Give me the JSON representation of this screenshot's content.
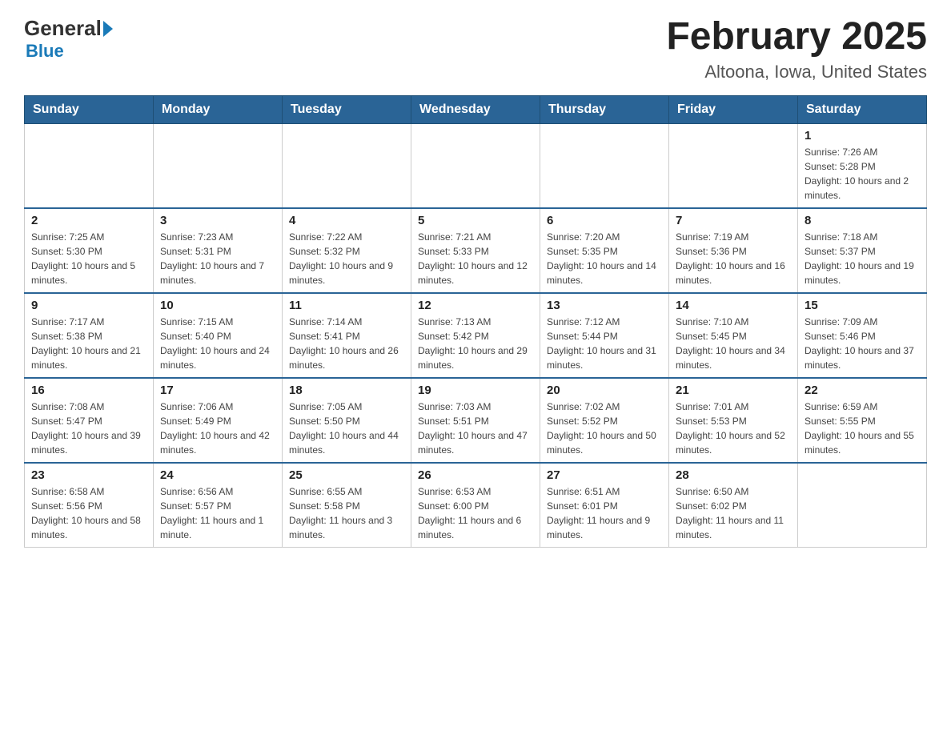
{
  "logo": {
    "general": "General",
    "blue": "Blue"
  },
  "header": {
    "title": "February 2025",
    "subtitle": "Altoona, Iowa, United States"
  },
  "weekdays": [
    "Sunday",
    "Monday",
    "Tuesday",
    "Wednesday",
    "Thursday",
    "Friday",
    "Saturday"
  ],
  "weeks": [
    [
      {
        "day": "",
        "info": ""
      },
      {
        "day": "",
        "info": ""
      },
      {
        "day": "",
        "info": ""
      },
      {
        "day": "",
        "info": ""
      },
      {
        "day": "",
        "info": ""
      },
      {
        "day": "",
        "info": ""
      },
      {
        "day": "1",
        "info": "Sunrise: 7:26 AM\nSunset: 5:28 PM\nDaylight: 10 hours and 2 minutes."
      }
    ],
    [
      {
        "day": "2",
        "info": "Sunrise: 7:25 AM\nSunset: 5:30 PM\nDaylight: 10 hours and 5 minutes."
      },
      {
        "day": "3",
        "info": "Sunrise: 7:23 AM\nSunset: 5:31 PM\nDaylight: 10 hours and 7 minutes."
      },
      {
        "day": "4",
        "info": "Sunrise: 7:22 AM\nSunset: 5:32 PM\nDaylight: 10 hours and 9 minutes."
      },
      {
        "day": "5",
        "info": "Sunrise: 7:21 AM\nSunset: 5:33 PM\nDaylight: 10 hours and 12 minutes."
      },
      {
        "day": "6",
        "info": "Sunrise: 7:20 AM\nSunset: 5:35 PM\nDaylight: 10 hours and 14 minutes."
      },
      {
        "day": "7",
        "info": "Sunrise: 7:19 AM\nSunset: 5:36 PM\nDaylight: 10 hours and 16 minutes."
      },
      {
        "day": "8",
        "info": "Sunrise: 7:18 AM\nSunset: 5:37 PM\nDaylight: 10 hours and 19 minutes."
      }
    ],
    [
      {
        "day": "9",
        "info": "Sunrise: 7:17 AM\nSunset: 5:38 PM\nDaylight: 10 hours and 21 minutes."
      },
      {
        "day": "10",
        "info": "Sunrise: 7:15 AM\nSunset: 5:40 PM\nDaylight: 10 hours and 24 minutes."
      },
      {
        "day": "11",
        "info": "Sunrise: 7:14 AM\nSunset: 5:41 PM\nDaylight: 10 hours and 26 minutes."
      },
      {
        "day": "12",
        "info": "Sunrise: 7:13 AM\nSunset: 5:42 PM\nDaylight: 10 hours and 29 minutes."
      },
      {
        "day": "13",
        "info": "Sunrise: 7:12 AM\nSunset: 5:44 PM\nDaylight: 10 hours and 31 minutes."
      },
      {
        "day": "14",
        "info": "Sunrise: 7:10 AM\nSunset: 5:45 PM\nDaylight: 10 hours and 34 minutes."
      },
      {
        "day": "15",
        "info": "Sunrise: 7:09 AM\nSunset: 5:46 PM\nDaylight: 10 hours and 37 minutes."
      }
    ],
    [
      {
        "day": "16",
        "info": "Sunrise: 7:08 AM\nSunset: 5:47 PM\nDaylight: 10 hours and 39 minutes."
      },
      {
        "day": "17",
        "info": "Sunrise: 7:06 AM\nSunset: 5:49 PM\nDaylight: 10 hours and 42 minutes."
      },
      {
        "day": "18",
        "info": "Sunrise: 7:05 AM\nSunset: 5:50 PM\nDaylight: 10 hours and 44 minutes."
      },
      {
        "day": "19",
        "info": "Sunrise: 7:03 AM\nSunset: 5:51 PM\nDaylight: 10 hours and 47 minutes."
      },
      {
        "day": "20",
        "info": "Sunrise: 7:02 AM\nSunset: 5:52 PM\nDaylight: 10 hours and 50 minutes."
      },
      {
        "day": "21",
        "info": "Sunrise: 7:01 AM\nSunset: 5:53 PM\nDaylight: 10 hours and 52 minutes."
      },
      {
        "day": "22",
        "info": "Sunrise: 6:59 AM\nSunset: 5:55 PM\nDaylight: 10 hours and 55 minutes."
      }
    ],
    [
      {
        "day": "23",
        "info": "Sunrise: 6:58 AM\nSunset: 5:56 PM\nDaylight: 10 hours and 58 minutes."
      },
      {
        "day": "24",
        "info": "Sunrise: 6:56 AM\nSunset: 5:57 PM\nDaylight: 11 hours and 1 minute."
      },
      {
        "day": "25",
        "info": "Sunrise: 6:55 AM\nSunset: 5:58 PM\nDaylight: 11 hours and 3 minutes."
      },
      {
        "day": "26",
        "info": "Sunrise: 6:53 AM\nSunset: 6:00 PM\nDaylight: 11 hours and 6 minutes."
      },
      {
        "day": "27",
        "info": "Sunrise: 6:51 AM\nSunset: 6:01 PM\nDaylight: 11 hours and 9 minutes."
      },
      {
        "day": "28",
        "info": "Sunrise: 6:50 AM\nSunset: 6:02 PM\nDaylight: 11 hours and 11 minutes."
      },
      {
        "day": "",
        "info": ""
      }
    ]
  ]
}
